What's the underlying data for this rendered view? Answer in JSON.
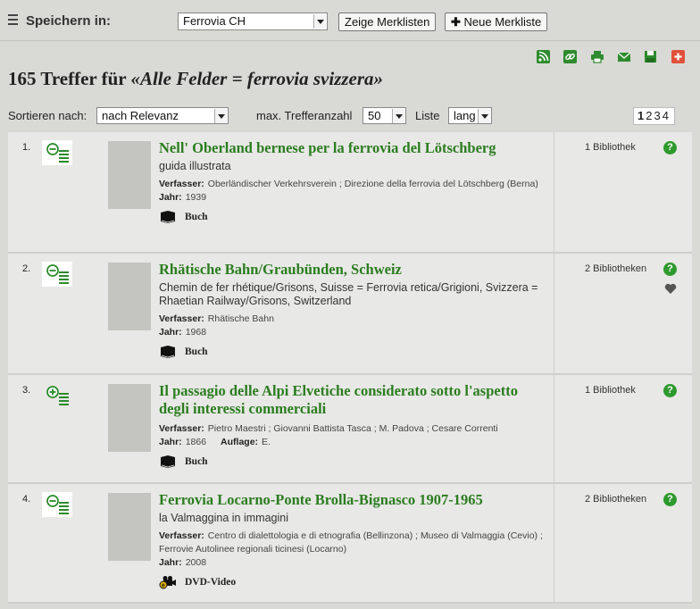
{
  "savebar": {
    "label": "Speichern in:",
    "list_value": "Ferrovia CH",
    "show_lists_button": "Zeige Merklisten",
    "new_list_button": "Neue Merkliste"
  },
  "tools": [
    "rss-icon",
    "link-icon",
    "print-icon",
    "mail-icon",
    "save-icon",
    "add-icon"
  ],
  "heading": {
    "count": "165 Treffer für",
    "query": "«Alle Felder = ferrovia svizzera»"
  },
  "sortbar": {
    "sort_label": "Sortieren nach:",
    "sort_value": "nach Relevanz",
    "max_label": "max. Trefferanzahl",
    "max_value": "50",
    "list_label": "Liste",
    "list_value": "lang",
    "pages": [
      "1",
      "2",
      "3",
      "4"
    ],
    "current_page": "1"
  },
  "results": [
    {
      "num": "1.",
      "list_state": "remove",
      "title": "Nell' Oberland bernese per la ferrovia del Lötschberg",
      "subtitle": "guida illustrata",
      "author_label": "Verfasser:",
      "author": "Oberländischer Verkehrsverein ; Direzione della ferrovia del Lötschberg (Berna)",
      "year_label": "Jahr:",
      "year": "1939",
      "edition_label": "",
      "edition": "",
      "media": "Buch",
      "media_icon": "book-icon",
      "libraries": "1  Bibliothek",
      "favorite": false
    },
    {
      "num": "2.",
      "list_state": "remove",
      "title": "Rhätische Bahn/Graubünden, Schweiz",
      "subtitle": "Chemin de fer rhétique/Grisons, Suisse = Ferrovia retica/Grigioni, Svizzera = Rhaetian Railway/Grisons, Switzerland",
      "author_label": "Verfasser:",
      "author": "Rhätische Bahn",
      "year_label": "Jahr:",
      "year": "1968",
      "edition_label": "",
      "edition": "",
      "media": "Buch",
      "media_icon": "book-icon",
      "libraries": "2  Bibliotheken",
      "favorite": true
    },
    {
      "num": "3.",
      "list_state": "add",
      "title": "Il passagio delle Alpi Elvetiche considerato sotto l'aspetto degli interessi commerciali",
      "subtitle": "",
      "author_label": "Verfasser:",
      "author": "Pietro Maestri ; Giovanni Battista Tasca ; M. Padova ; Cesare Correnti",
      "year_label": "Jahr:",
      "year": "1866",
      "edition_label": "Auflage:",
      "edition": "E.",
      "media": "Buch",
      "media_icon": "book-icon",
      "libraries": "1  Bibliothek",
      "favorite": false
    },
    {
      "num": "4.",
      "list_state": "remove",
      "title": "Ferrovia Locarno-Ponte Brolla-Bignasco 1907-1965",
      "subtitle": "la Valmaggina in immagini",
      "author_label": "Verfasser:",
      "author": "Centro di dialettologia e di etnografia (Bellinzona) ; Museo di Valmaggia (Cevio) ; Ferrovie Autolinee regionali ticinesi (Locarno)",
      "year_label": "Jahr:",
      "year": "2008",
      "edition_label": "",
      "edition": "",
      "media": "DVD-Video",
      "media_icon": "video-camera-icon",
      "libraries": "2  Bibliotheken",
      "favorite": false
    }
  ]
}
